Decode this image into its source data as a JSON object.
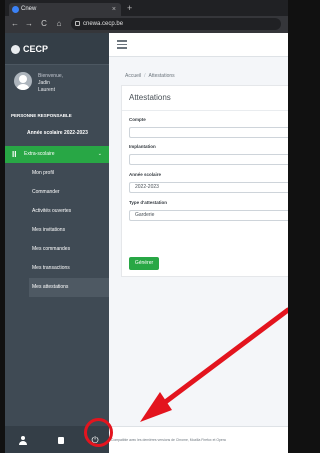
{
  "browser": {
    "tab_title": "Cnew",
    "tab_close": "×",
    "new_tab": "+",
    "url": "cnewa.cecp.be",
    "back": "←",
    "forward": "→",
    "reload": "C",
    "home": "⌂"
  },
  "brand": {
    "name": "CECP"
  },
  "user": {
    "welcome": "Bienvenue,",
    "name_line1": "Jadin",
    "name_line2": "Laurent"
  },
  "sidebar": {
    "section_label": "PERSONNE RESPONSABLE",
    "year_item": "Année scolaire 2022-2023",
    "group_label": "Extra-scolaire",
    "group_icon": "ll",
    "group_chevron": "⌄",
    "items": [
      {
        "label": "Mon profil"
      },
      {
        "label": "Commander"
      },
      {
        "label": "Activités ouvertes"
      },
      {
        "label": "Mes invitations"
      },
      {
        "label": "Mes commandes"
      },
      {
        "label": "Mes transactions"
      },
      {
        "label": "Mes attestations"
      }
    ],
    "footer_power": "⏻"
  },
  "breadcrumb": {
    "home": "Accueil",
    "sep": "/",
    "current": "Attestations"
  },
  "form": {
    "title": "Attestations",
    "fields": {
      "compte_label": "Compte",
      "compte_value": "",
      "implantation_label": "Implantation",
      "implantation_value": "",
      "annee_label": "Année scolaire",
      "annee_value": "2022-2023",
      "type_label": "Type d'attestation",
      "type_value": "Garderie"
    },
    "submit_label": "Générer"
  },
  "footer": {
    "text": "Compatible avec les dernières versions de Chrome, Mozilla Firefox et Opera"
  },
  "colors": {
    "sidebar_bg": "#3f4a54",
    "accent_green": "#28a745",
    "annotation_red": "#e3141e"
  }
}
